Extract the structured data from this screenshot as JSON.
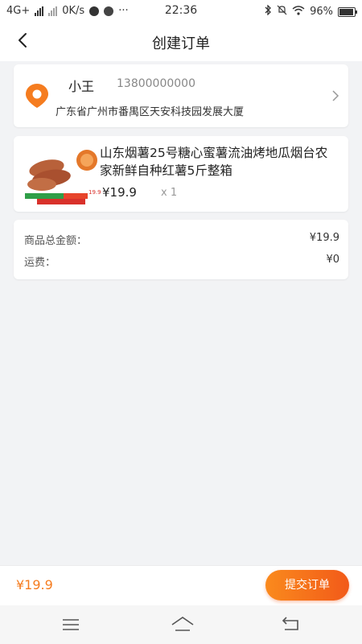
{
  "status_bar": {
    "network": "4G+",
    "speed": "0K/s",
    "time": "22:36",
    "more": "···",
    "battery": "96%",
    "battery_level": 0.96
  },
  "header": {
    "title": "创建订单",
    "back_icon": "chevron-left-icon"
  },
  "address": {
    "name": "小王",
    "phone": "13800000000",
    "detail": "广东省广州市番禺区天安科技园发展大厦",
    "pin_icon": "location-pin-icon",
    "arrow_icon": "chevron-right-icon"
  },
  "product": {
    "title": "山东烟薯25号糖心蜜薯流油烤地瓜烟台农家新鲜自种红薯5斤整箱",
    "price": "¥19.9",
    "quantity": "x 1",
    "thumb_badge_price": "19.9"
  },
  "summary": {
    "rows": [
      {
        "label": "商品总金额：",
        "value": "¥19.9"
      },
      {
        "label": "运费：",
        "value": "¥0"
      }
    ]
  },
  "footer": {
    "total": "¥19.9",
    "submit_label": "提交订单"
  },
  "colors": {
    "accent": "#f57c1f",
    "button_start": "#fa8a1d",
    "button_end": "#f25a19"
  }
}
